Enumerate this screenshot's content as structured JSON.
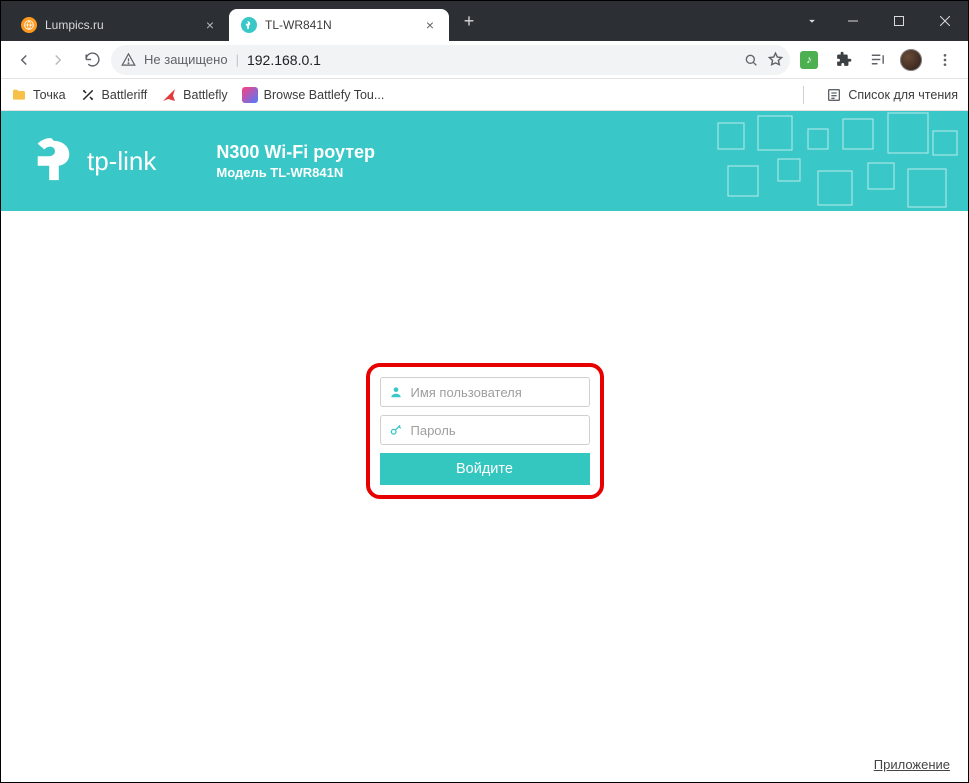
{
  "browser": {
    "tabs": [
      {
        "title": "Lumpics.ru",
        "active": false
      },
      {
        "title": "TL-WR841N",
        "active": true
      }
    ],
    "nav": {
      "security_label": "Не защищено",
      "url": "192.168.0.1"
    },
    "bookmarks": [
      {
        "label": "Точка"
      },
      {
        "label": "Battleriff"
      },
      {
        "label": "Battlefly"
      },
      {
        "label": "Browse Battlefy Tou..."
      }
    ],
    "reading_list": "Список для чтения"
  },
  "router": {
    "brand": "tp-link",
    "product_title": "N300 Wi-Fi роутер",
    "model_line": "Модель TL-WR841N",
    "login": {
      "username_placeholder": "Имя пользователя",
      "password_placeholder": "Пароль",
      "button_label": "Войдите"
    },
    "app_link": "Приложение"
  }
}
